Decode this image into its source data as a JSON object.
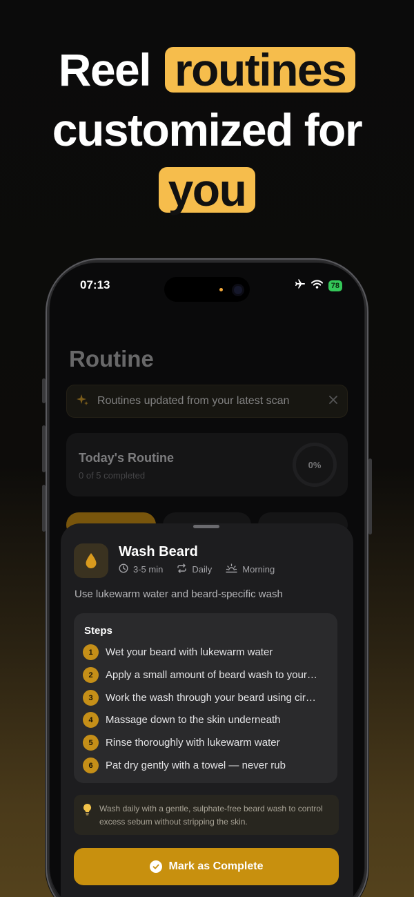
{
  "headline": {
    "line1_text": "Reel",
    "line1_highlight": "routines",
    "line2_text": "customized for",
    "line3_highlight": "you"
  },
  "colors": {
    "accent": "#f6bd4c",
    "button": "#c8900e",
    "step_badge": "#c58f18",
    "battery": "#34c759"
  },
  "status_bar": {
    "time": "07:13",
    "battery": "78",
    "icons": [
      "airplane-icon",
      "wifi-icon",
      "battery-icon"
    ]
  },
  "screen": {
    "title": "Routine",
    "banner": {
      "icon": "sparkle-icon",
      "text": "Routines updated from your latest scan",
      "close_icon": "close-icon"
    },
    "today": {
      "title": "Today's Routine",
      "subtitle": "0 of 5 completed",
      "progress_label": "0%",
      "progress": 0
    }
  },
  "sheet": {
    "task": {
      "icon": "water-drop-icon",
      "title": "Wash Beard",
      "duration": "3-5 min",
      "frequency": "Daily",
      "time_of_day": "Morning",
      "description": "Use lukewarm water and beard-specific wash"
    },
    "steps_title": "Steps",
    "steps": [
      {
        "num": "1",
        "text": "Wet your beard with lukewarm water"
      },
      {
        "num": "2",
        "text": "Apply a small amount of beard wash to your…"
      },
      {
        "num": "3",
        "text": "Work the wash through your beard using cir…"
      },
      {
        "num": "4",
        "text": "Massage down to the skin underneath"
      },
      {
        "num": "5",
        "text": "Rinse thoroughly with lukewarm water"
      },
      {
        "num": "6",
        "text": "Pat dry gently with a towel — never rub"
      }
    ],
    "tip": {
      "icon": "lightbulb-icon",
      "text": "Wash daily with a gentle, sulphate-free beard wash to control excess sebum without stripping the skin."
    },
    "complete_button": "Mark as Complete"
  }
}
